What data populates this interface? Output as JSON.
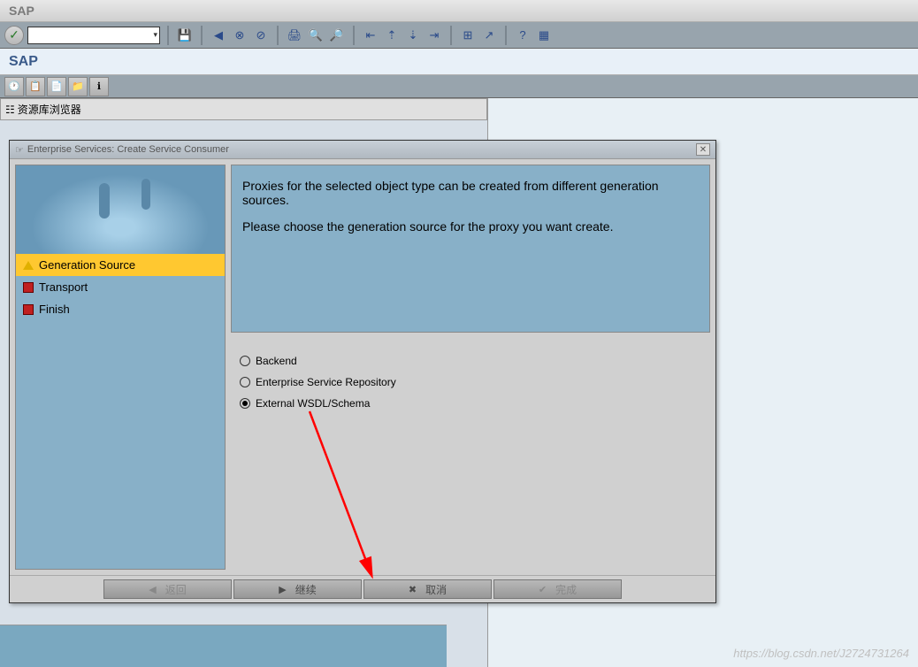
{
  "title_bar": "SAP",
  "header": "SAP",
  "browser_title": "资源库浏览器",
  "dialog": {
    "title": "Enterprise Services: Create Service Consumer",
    "info_line1": "Proxies for the selected object type can be created from different generation sources.",
    "info_line2": "Please choose the generation source for the proxy you want create.",
    "nav": [
      {
        "label": "Generation Source",
        "active": true,
        "marker": "warn"
      },
      {
        "label": "Transport",
        "active": false,
        "marker": "stop"
      },
      {
        "label": "Finish",
        "active": false,
        "marker": "stop"
      }
    ],
    "radios": [
      {
        "label": "Backend",
        "checked": false
      },
      {
        "label": "Enterprise Service Repository",
        "checked": false
      },
      {
        "label": "External WSDL/Schema",
        "checked": true
      }
    ],
    "buttons": {
      "back": "返回",
      "continue": "继续",
      "cancel": "取消",
      "finish": "完成"
    }
  },
  "watermark": "https://blog.csdn.net/J2724731264"
}
